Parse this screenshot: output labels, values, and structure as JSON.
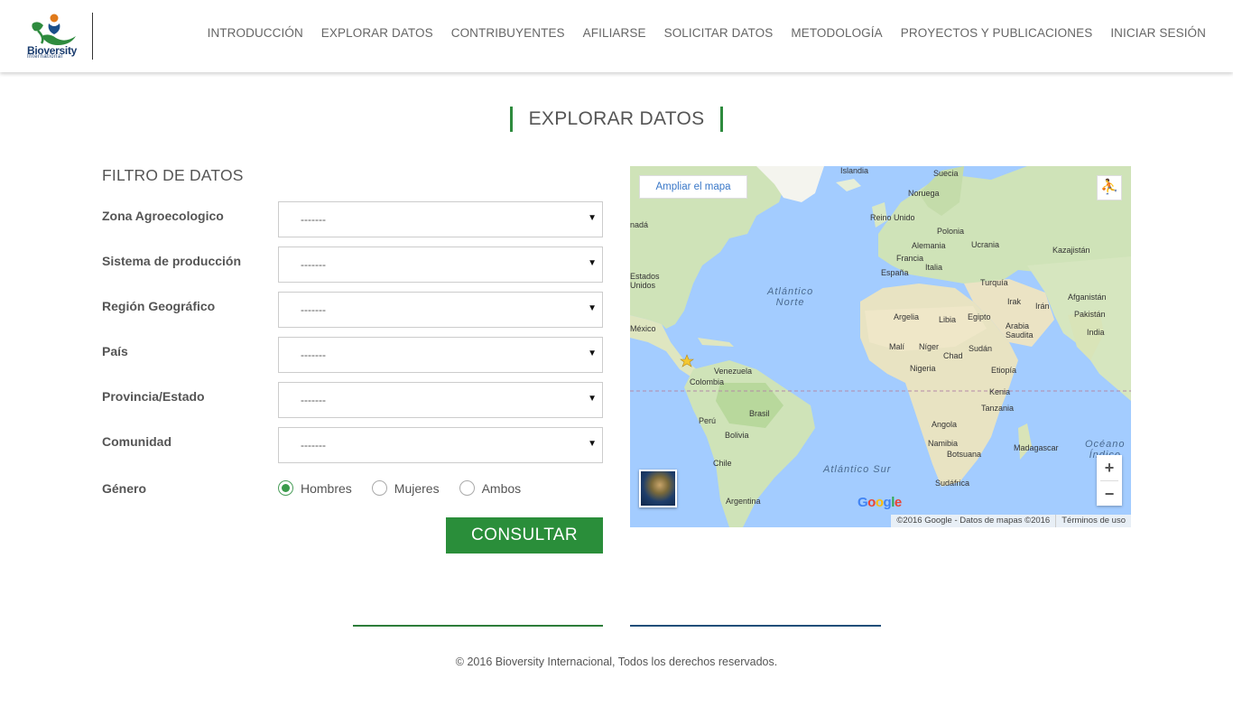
{
  "header": {
    "logo_text": "Bioversity",
    "logo_sub": "International",
    "nav": [
      "INTRODUCCIÓN",
      "EXPLORAR DATOS",
      "CONTRIBUYENTES",
      "AFILIARSE",
      "SOLICITAR DATOS",
      "METODOLOGÍA",
      "PROYECTOS Y PUBLICACIONES",
      "INICIAR SESIÓN"
    ]
  },
  "page_title": "EXPLORAR DATOS",
  "filter": {
    "title": "FILTRO DE DATOS",
    "fields": [
      {
        "label": "Zona Agroecologico",
        "value": "-------"
      },
      {
        "label": "Sistema de producción",
        "value": "-------"
      },
      {
        "label": "Región Geográfico",
        "value": "-------"
      },
      {
        "label": "País",
        "value": "-------"
      },
      {
        "label": "Provincia/Estado",
        "value": "-------"
      },
      {
        "label": "Comunidad",
        "value": "-------"
      }
    ],
    "gender": {
      "label": "Género",
      "options": [
        "Hombres",
        "Mujeres",
        "Ambos"
      ],
      "selected": "Hombres"
    },
    "submit_label": "CONSULTAR"
  },
  "map": {
    "enlarge_label": "Ampliar el mapa",
    "pegman_icon": "pegman-icon",
    "zoom_in": "+",
    "zoom_out": "−",
    "google_logo": "Google",
    "attribution": "©2016 Google - Datos de mapas ©2016",
    "terms": "Términos de uso",
    "labels": {
      "islandia": "Islandia",
      "suecia": "Suecia",
      "noruega": "Noruega",
      "reino_unido": "Reino Unido",
      "polonia": "Polonia",
      "alemania": "Alemania",
      "ucrania": "Ucrania",
      "kazajistan": "Kazajistán",
      "francia": "Francia",
      "italia": "Italia",
      "espana": "España",
      "turquia": "Turquía",
      "afganistan": "Afganistán",
      "irak": "Irak",
      "iran": "Irán",
      "pakistan": "Pakistán",
      "argelia": "Argelia",
      "libia": "Libia",
      "egipto": "Egipto",
      "arabia": "Arabia\nSaudita",
      "india": "India",
      "mali": "Malí",
      "niger": "Níger",
      "chad": "Chad",
      "sudan": "Sudán",
      "nigeria": "Nigeria",
      "etiopia": "Etiopía",
      "kenia": "Kenia",
      "tanzania": "Tanzania",
      "angola": "Angola",
      "namibia": "Namibia",
      "botsuana": "Botsuana",
      "madagascar": "Madagascar",
      "sudafrica": "Sudáfrica",
      "canada": "nadá",
      "estados_unidos": "Estados\nUnidos",
      "mexico": "México",
      "venezuela": "Venezuela",
      "colombia": "Colombia",
      "peru": "Perú",
      "brasil": "Brasil",
      "bolivia": "Bolivia",
      "chile": "Chile",
      "argentina": "Argentina",
      "atlantico_norte": "Atlántico\nNorte",
      "atlantico_sur": "Atlántico Sur",
      "oceano_indico": "Océano\nÍndico"
    }
  },
  "footer": {
    "copyright": "© 2016 Bioversity Internacional, Todos los derechos reservados."
  }
}
